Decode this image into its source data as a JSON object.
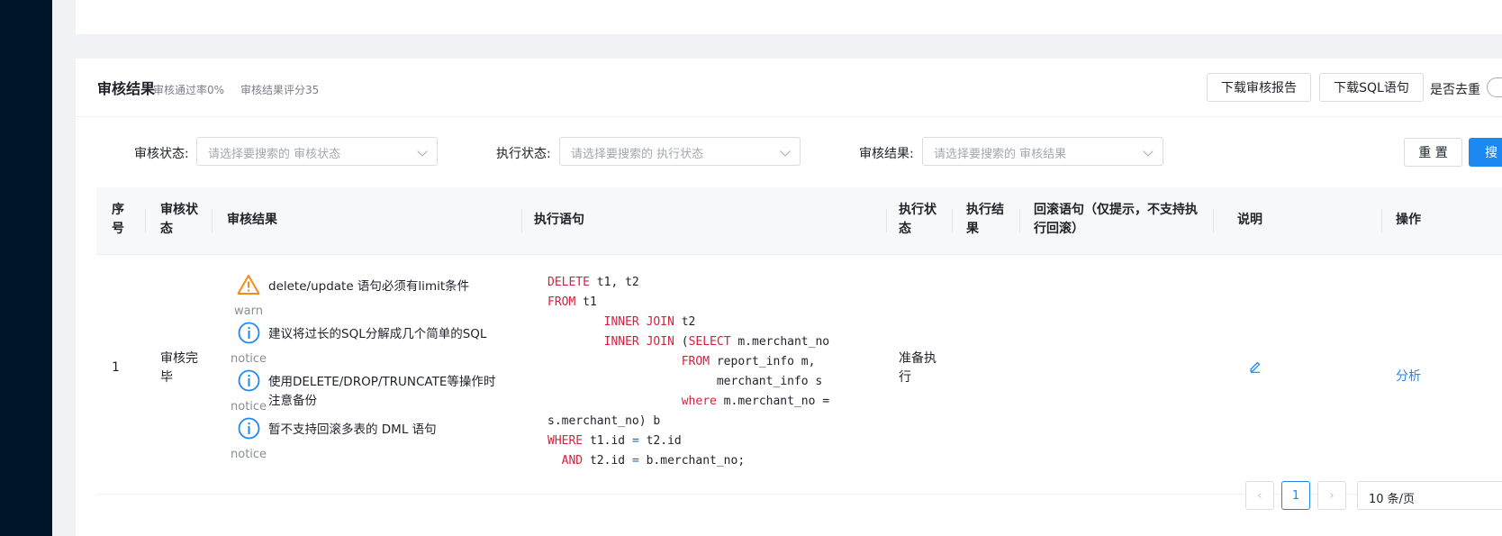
{
  "card": {
    "title": "审核结果",
    "pass_rate": "审核通过率0%",
    "score": "审核结果评分35"
  },
  "actions": {
    "download_report": "下载审核报告",
    "download_sql": "下载SQL语句",
    "dedup_label": "是否去重"
  },
  "filters": {
    "audit_status_label": "审核状态:",
    "audit_status_placeholder": "请选择要搜索的 审核状态",
    "exec_status_label": "执行状态:",
    "exec_status_placeholder": "请选择要搜索的 执行状态",
    "audit_result_label": "审核结果:",
    "audit_result_placeholder": "请选择要搜索的 审核结果",
    "reset": "重 置",
    "search": "搜 索"
  },
  "table": {
    "headers": [
      "序号",
      "审核状态",
      "审核结果",
      "执行语句",
      "执行状态",
      "执行结果",
      "回滚语句（仅提示，不支持执行回滚）",
      "说明",
      "操作"
    ],
    "rows": [
      {
        "index": "1",
        "audit_status": "审核完毕",
        "audit_results": [
          {
            "level": "warn",
            "icon": "warning-triangle-icon",
            "text": "delete/update 语句必须有limit条件"
          },
          {
            "level": "notice",
            "icon": "info-circle-icon",
            "text": "建议将过长的SQL分解成几个简单的SQL"
          },
          {
            "level": "notice",
            "icon": "info-circle-icon",
            "text": "使用DELETE/DROP/TRUNCATE等操作时注意备份"
          },
          {
            "level": "notice",
            "icon": "info-circle-icon",
            "text": "暂不支持回滚多表的 DML 语句"
          }
        ],
        "sql": "DELETE t1, t2\nFROM t1\n        INNER JOIN t2\n        INNER JOIN (SELECT m.merchant_no\n                   FROM report_info m,\n                        merchant_info s\n                   where m.merchant_no =\ns.merchant_no) b\nWHERE t1.id = t2.id\n  AND t2.id = b.merchant_no;",
        "exec_status": "准备执行",
        "exec_result": "",
        "rollback": "",
        "note_icon": "edit-icon",
        "action": "分析"
      }
    ]
  },
  "pagination": {
    "current_page": "1",
    "page_size": "10 条/页"
  },
  "colors": {
    "primary": "#1e88f2",
    "warn": "#f08c1e",
    "sql_keyword": "#d4213d",
    "sidebar": "#001529"
  }
}
